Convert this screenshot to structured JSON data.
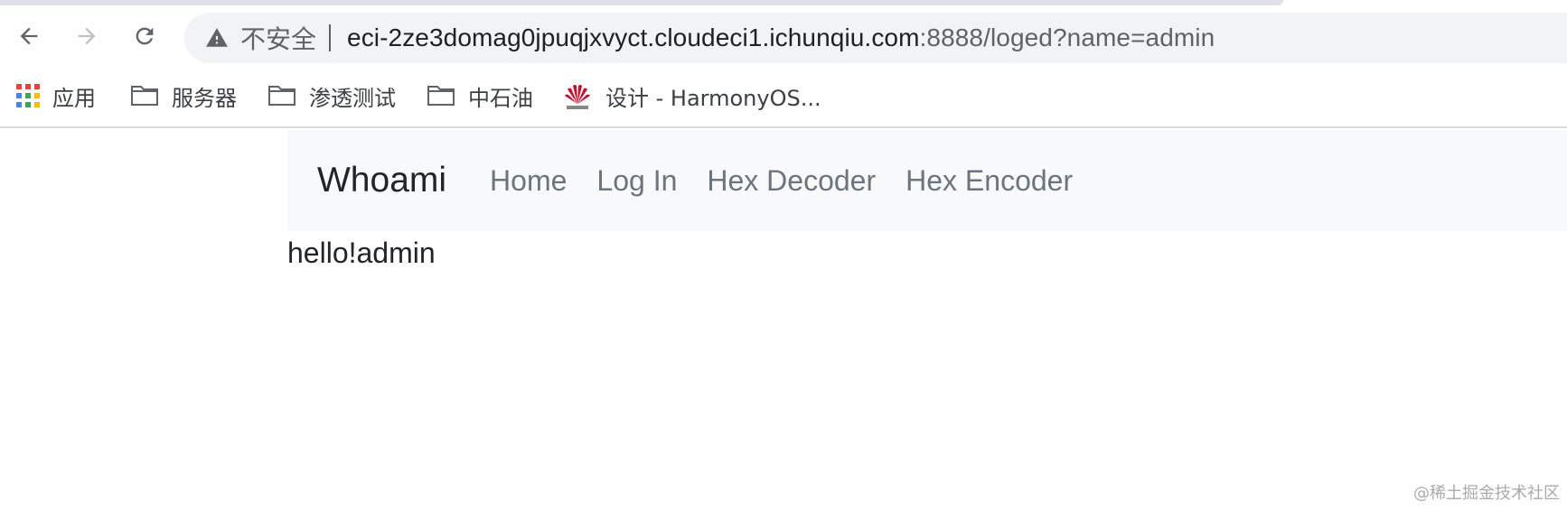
{
  "browser": {
    "security_label": "不安全",
    "url_host": "eci-2ze3domag0jpuqjxvyct.cloudeci1.ichunqiu.com",
    "url_rest": ":8888/loged?name=admin"
  },
  "bookmarks": [
    {
      "label": "应用",
      "icon": "apps-grid-icon"
    },
    {
      "label": "服务器",
      "icon": "folder-icon"
    },
    {
      "label": "渗透测试",
      "icon": "folder-icon"
    },
    {
      "label": "中石油",
      "icon": "folder-icon"
    },
    {
      "label": "设计 - HarmonyOS...",
      "icon": "huawei-logo-icon"
    }
  ],
  "navbar": {
    "brand": "Whoami",
    "links": [
      "Home",
      "Log In",
      "Hex Decoder",
      "Hex Encoder"
    ]
  },
  "main": {
    "greeting": "hello!admin"
  },
  "watermark": "@稀土掘金技术社区",
  "colors": {
    "navbar_bg": "#f8f9fa",
    "link": "#6c757d",
    "text": "#212529",
    "omnibox_bg": "#f1f3f4"
  }
}
